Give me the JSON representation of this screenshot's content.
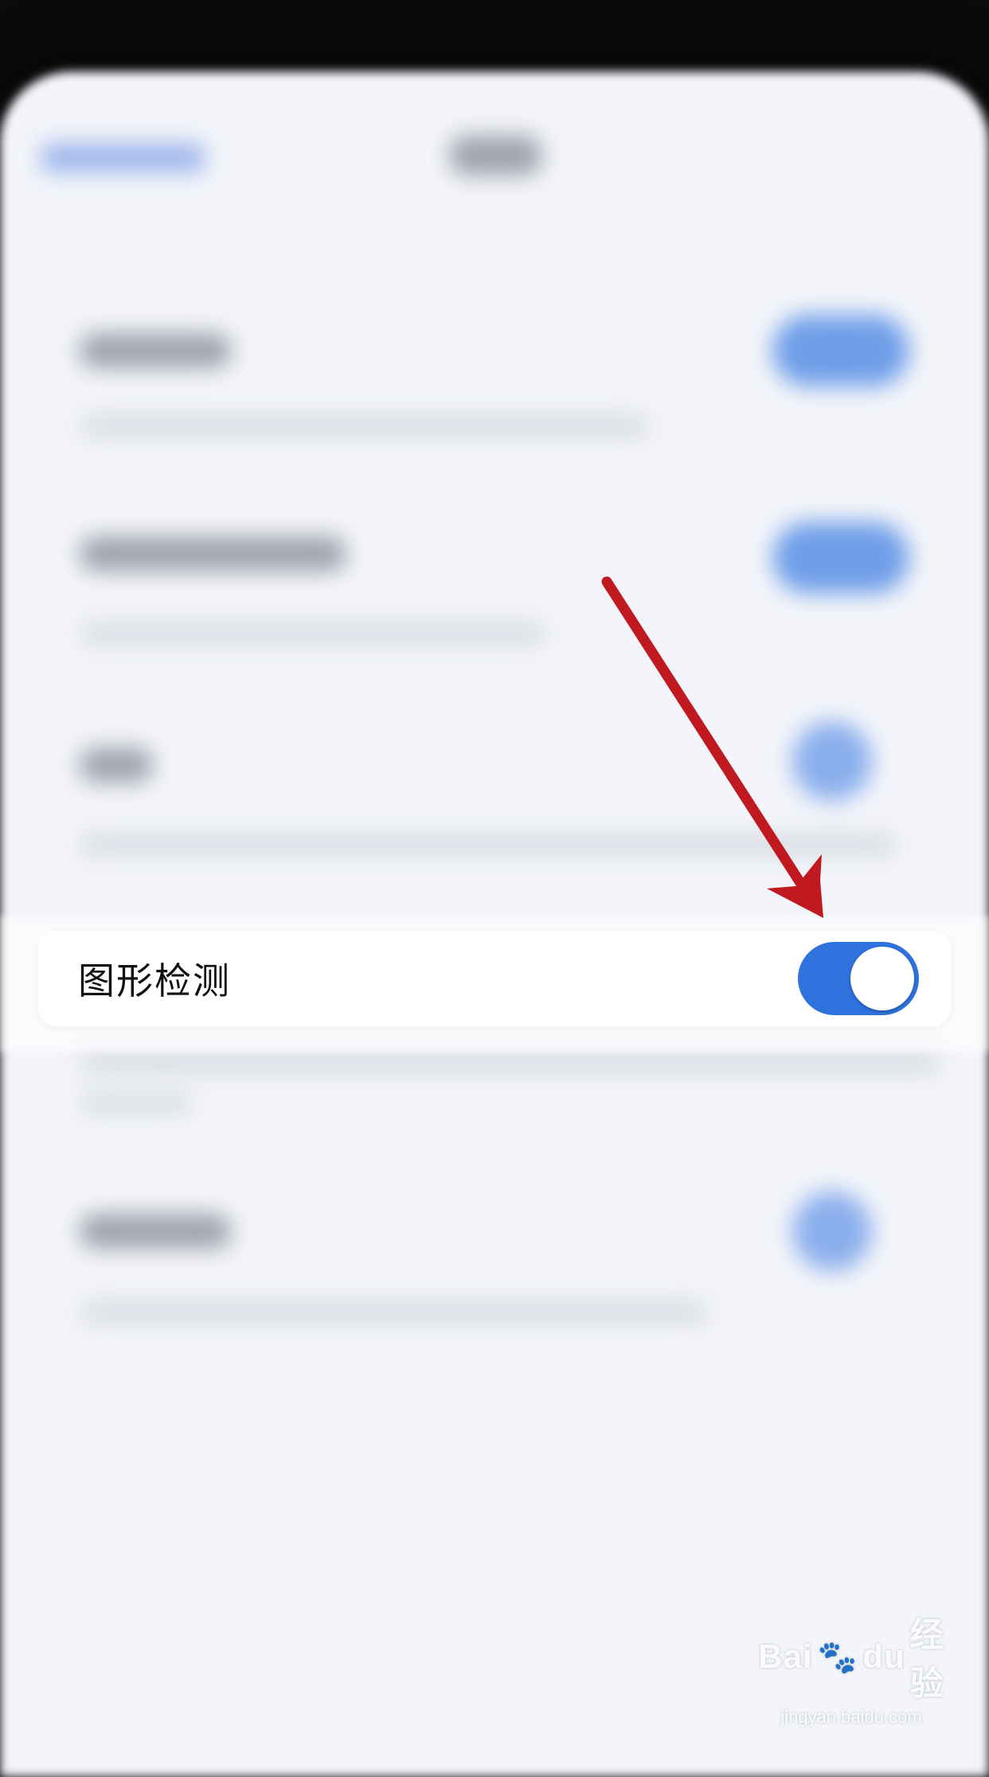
{
  "setting": {
    "label": "图形检测",
    "enabled": true
  },
  "watermark": {
    "brand_left": "Bai",
    "brand_right": "du",
    "brand_suffix": "经验",
    "url": "jingyan.baidu.com"
  },
  "colors": {
    "toggle_on": "#2f72de",
    "arrow": "#c0191f",
    "background": "#f3f5fa"
  },
  "icons": {
    "annotation": "red-arrow-icon",
    "watermark_logo": "baidu-paw-icon"
  }
}
